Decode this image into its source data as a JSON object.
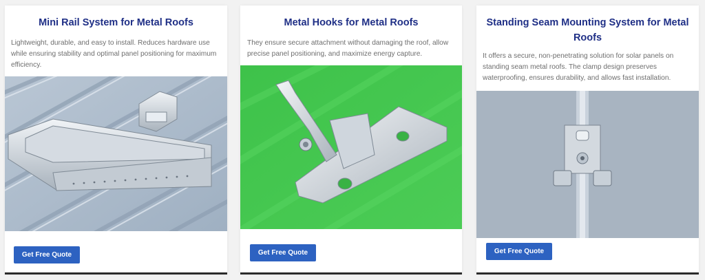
{
  "cards": [
    {
      "title": "Mini Rail System for Metal Roofs",
      "description": "Lightweight, durable, and easy to install. Reduces hardware use while ensuring stability and optimal panel positioning for maximum efficiency.",
      "image_alt": "Mini rail mounted on corrugated metal roof",
      "button_label": "Get Free Quote"
    },
    {
      "title": "Metal Hooks for Metal Roofs",
      "description": " They ensure secure attachment without damaging the roof, allow precise panel positioning, and maximize energy capture.",
      "image_alt": "Metal hook bracket on green background",
      "button_label": "Get Free Quote"
    },
    {
      "title": "Standing Seam Mounting System for Metal Roofs",
      "description": "It offers a secure, non-penetrating solution for solar panels on standing seam metal roofs. The clamp design preserves waterproofing, ensures durability, and allows fast installation.",
      "image_alt": "Standing seam clamp on seam",
      "button_label": "Get Free Quote"
    }
  ],
  "colors": {
    "title": "#1f2f86",
    "button": "#2d62c1",
    "text": "#6e6e6e",
    "green_bg": "#43c24e",
    "steel_bg": "#a9b4c0"
  }
}
